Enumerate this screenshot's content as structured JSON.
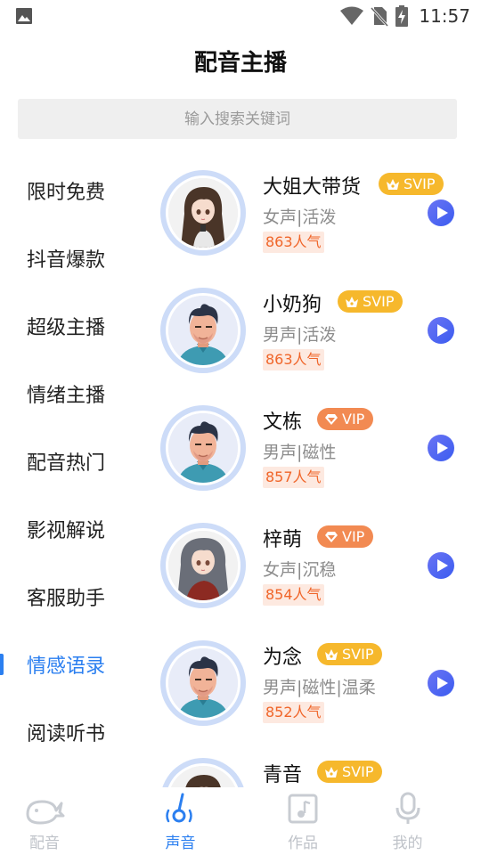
{
  "status_bar": {
    "time": "11:57"
  },
  "header": {
    "title": "配音主播"
  },
  "search": {
    "placeholder": "输入搜索关键词"
  },
  "categories": [
    {
      "label": "限时免费",
      "active": false
    },
    {
      "label": "抖音爆款",
      "active": false
    },
    {
      "label": "超级主播",
      "active": false
    },
    {
      "label": "情绪主播",
      "active": false
    },
    {
      "label": "配音热门",
      "active": false
    },
    {
      "label": "影视解说",
      "active": false
    },
    {
      "label": "客服助手",
      "active": false
    },
    {
      "label": "情感语录",
      "active": true
    },
    {
      "label": "阅读听书",
      "active": false
    }
  ],
  "voices": [
    {
      "name": "大姐大带货",
      "badge": "SVIP",
      "tags": "女声|活泼",
      "popularity": "863人气",
      "avatar": "anime-girl-avatar"
    },
    {
      "name": "小奶狗",
      "badge": "SVIP",
      "tags": "男声|活泼",
      "popularity": "863人气",
      "avatar": "man-avatar"
    },
    {
      "name": "文栋",
      "badge": "VIP",
      "tags": "男声|磁性",
      "popularity": "857人气",
      "avatar": "man-avatar"
    },
    {
      "name": "梓萌",
      "badge": "VIP",
      "tags": "女声|沉稳",
      "popularity": "854人气",
      "avatar": "anime-girl-gray-avatar"
    },
    {
      "name": "为念",
      "badge": "SVIP",
      "tags": "男声|磁性|温柔",
      "popularity": "852人气",
      "avatar": "man-avatar"
    },
    {
      "name": "青音",
      "badge": "SVIP",
      "tags": "",
      "popularity": "",
      "avatar": "anime-girl-avatar"
    }
  ],
  "bottom_nav": [
    {
      "label": "配音",
      "icon": "whale-icon",
      "active": false
    },
    {
      "label": "声音",
      "icon": "voice-icon",
      "active": true
    },
    {
      "label": "作品",
      "icon": "works-icon",
      "active": false
    },
    {
      "label": "我的",
      "icon": "microphone-icon",
      "active": false
    }
  ],
  "colors": {
    "accent": "#2b7ff0",
    "svip": "#f6b82c",
    "vip": "#f28a52",
    "popularity": "#f06529"
  }
}
